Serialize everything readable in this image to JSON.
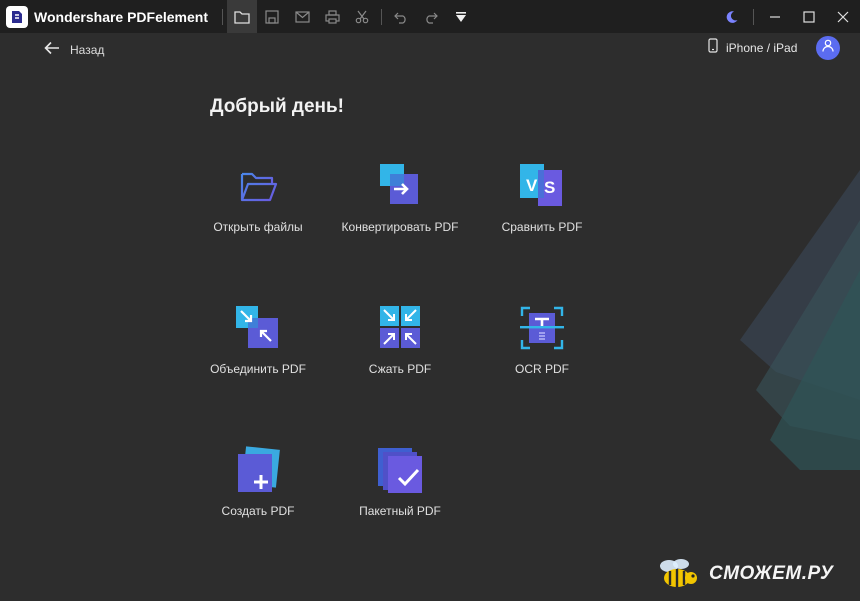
{
  "app": {
    "title": "Wondershare PDFelement"
  },
  "toolbar": {
    "icons": [
      "folder-icon",
      "save-icon",
      "mail-icon",
      "print-icon",
      "cut-icon",
      "undo-icon",
      "redo-icon",
      "dropdown-icon"
    ],
    "active": "folder-icon"
  },
  "window": {
    "icons": [
      "moon-icon",
      "minimize-icon",
      "maximize-icon",
      "close-icon"
    ]
  },
  "nav": {
    "back_label": "Назад"
  },
  "device": {
    "label": "iPhone / iPad",
    "icon": "phone-icon"
  },
  "main": {
    "greeting": "Добрый день!",
    "tiles": [
      {
        "label": "Открыть файлы",
        "icon": "open-folder-icon"
      },
      {
        "label": "Конвертировать PDF",
        "icon": "convert-pdf-icon"
      },
      {
        "label": "Сравнить PDF",
        "icon": "compare-pdf-icon"
      },
      {
        "label": "Объединить PDF",
        "icon": "merge-pdf-icon"
      },
      {
        "label": "Сжать PDF",
        "icon": "compress-pdf-icon"
      },
      {
        "label": "OCR PDF",
        "icon": "ocr-pdf-icon"
      },
      {
        "label": "Создать PDF",
        "icon": "create-pdf-icon"
      },
      {
        "label": "Пакетный PDF",
        "icon": "batch-pdf-icon"
      }
    ]
  },
  "watermark": {
    "text": "СМОЖЕМ.РУ"
  },
  "colors": {
    "background": "#2d2d2d",
    "titlebar": "#1f1f1f",
    "accent_blue": "#4a86e8",
    "accent_purple": "#5b5bd6",
    "avatar": "#5b6cf0"
  }
}
